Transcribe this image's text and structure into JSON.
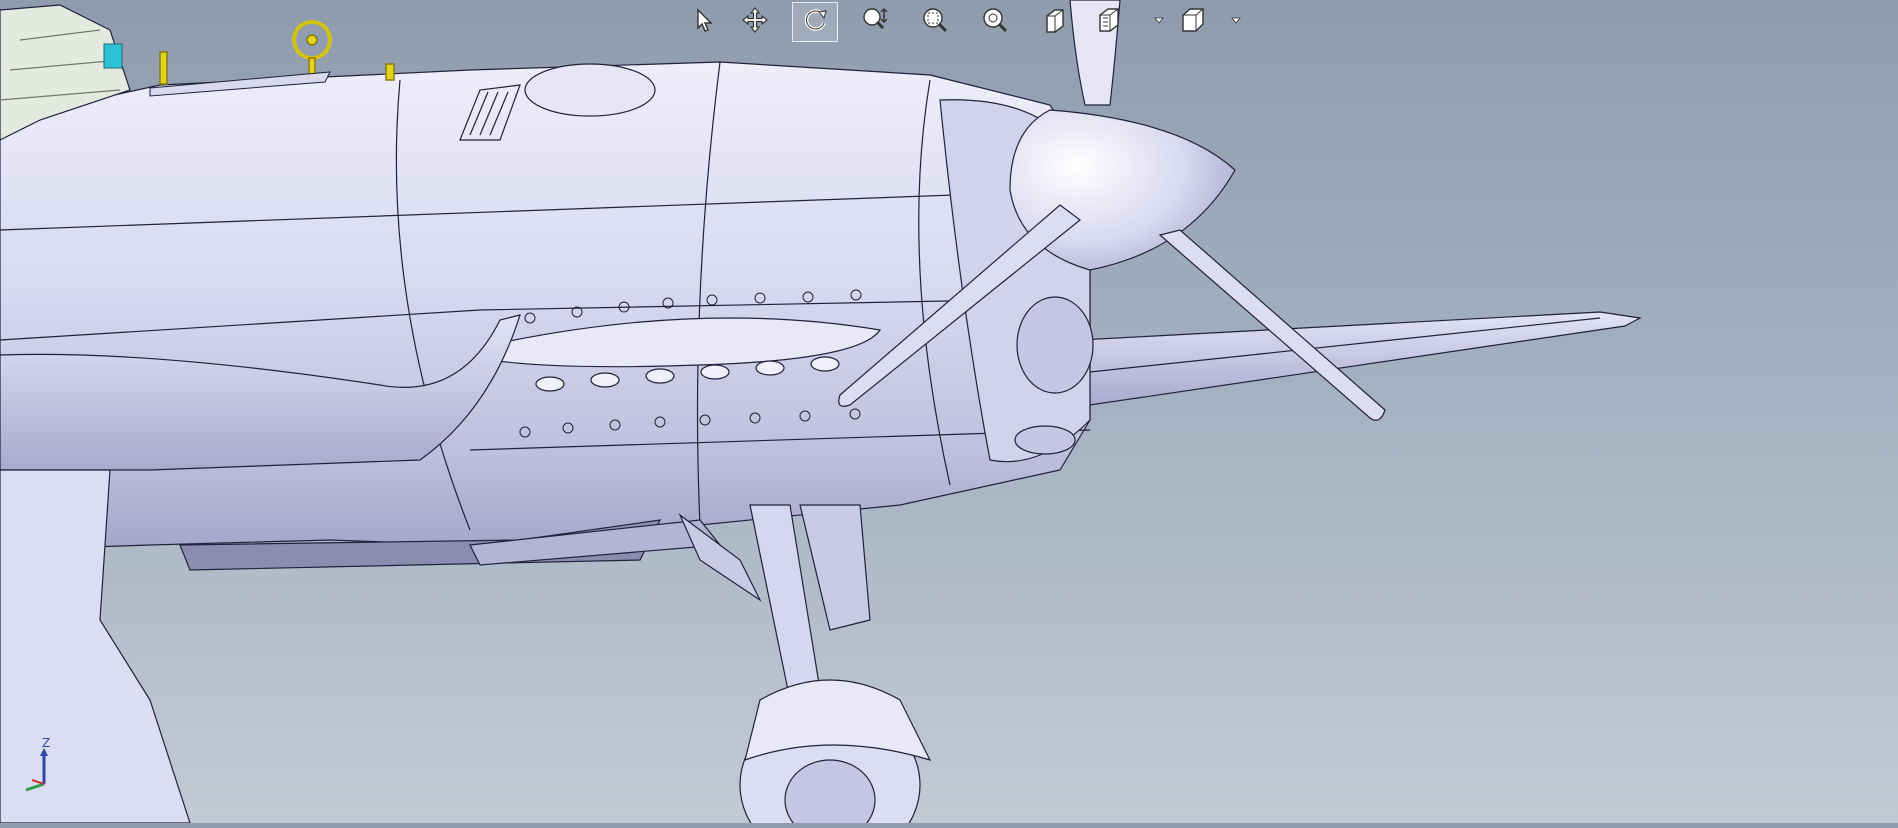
{
  "toolbar": {
    "items": [
      {
        "name": "select-icon",
        "active": false
      },
      {
        "name": "pan-icon",
        "active": false
      },
      {
        "name": "rotate-icon",
        "active": true
      },
      {
        "name": "zoom-dynamic-icon",
        "active": false
      },
      {
        "name": "zoom-window-icon",
        "active": false
      },
      {
        "name": "zoom-fit-icon",
        "active": false
      },
      {
        "name": "section-view-icon",
        "active": false
      },
      {
        "name": "display-style-icon",
        "active": false
      },
      {
        "name": "view-orientation-icon",
        "active": false
      }
    ]
  },
  "triad": {
    "axis_label": "Z",
    "colors": {
      "z": "#2b4aa8",
      "x": "#c0392b",
      "y": "#2e9e44"
    }
  },
  "model": {
    "body_color": "#dcdcf2",
    "shadow_color": "#9fa0c6",
    "line_color": "#20203a",
    "accent_yellow": "#e5d21c",
    "accent_cyan": "#2ec2d8"
  }
}
